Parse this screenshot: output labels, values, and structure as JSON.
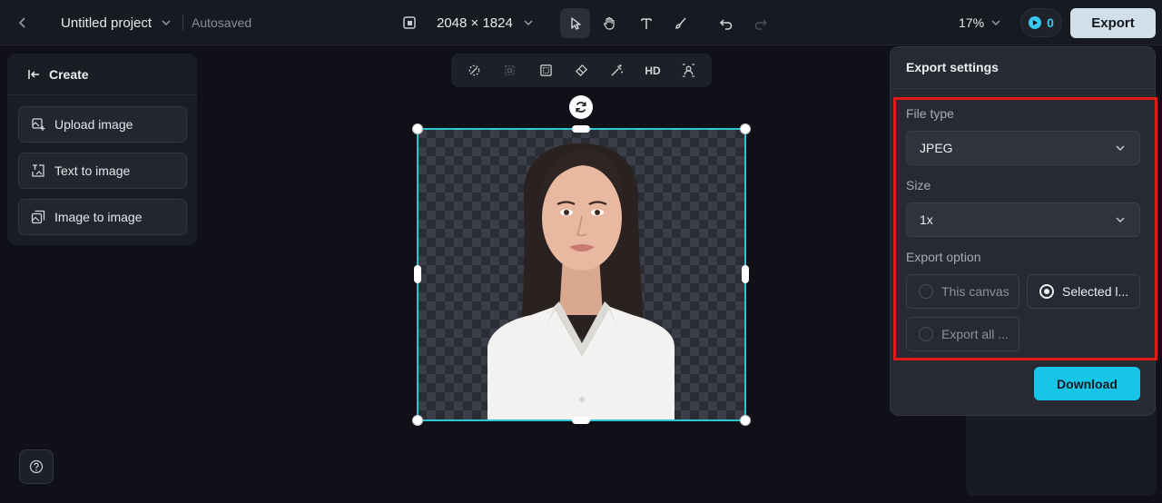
{
  "header": {
    "project_title": "Untitled project",
    "autosaved": "Autosaved",
    "dimensions": "2048 × 1824",
    "zoom": "17%",
    "credits": "0",
    "export_label": "Export"
  },
  "tools": [
    "select-tool",
    "hand-tool",
    "text-tool",
    "brush-tool",
    "undo",
    "redo"
  ],
  "left_panel": {
    "header": "Create",
    "buttons": [
      {
        "label": "Upload image",
        "icon": "upload-image-icon"
      },
      {
        "label": "Text to image",
        "icon": "text-to-image-icon"
      },
      {
        "label": "Image to image",
        "icon": "image-to-image-icon"
      }
    ]
  },
  "floating_toolbar": {
    "hd_label": "HD"
  },
  "export_panel": {
    "title": "Export settings",
    "file_type_label": "File type",
    "file_type_value": "JPEG",
    "size_label": "Size",
    "size_value": "1x",
    "export_option_label": "Export option",
    "options": [
      {
        "label": "This canvas",
        "selected": false
      },
      {
        "label": "Selected l...",
        "selected": true
      },
      {
        "label": "Export all ...",
        "selected": false
      }
    ],
    "download_label": "Download"
  },
  "colors": {
    "accent": "#17c6e6",
    "selection": "#2ec7cf",
    "highlight": "#e21a1a"
  }
}
